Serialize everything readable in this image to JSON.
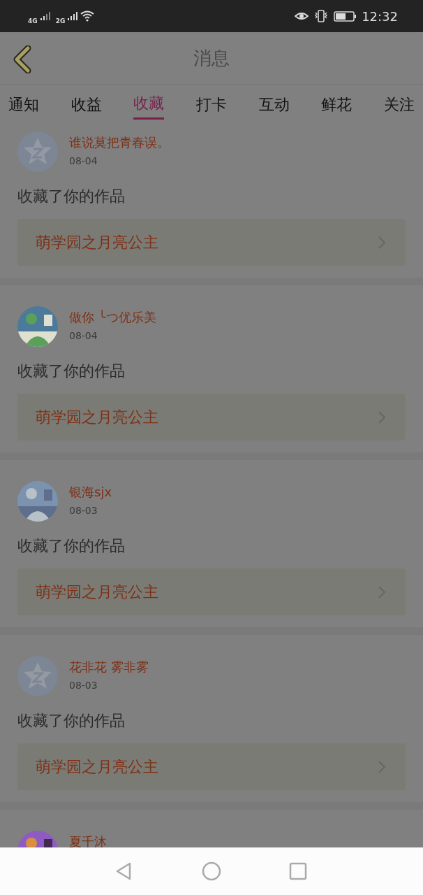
{
  "status_bar": {
    "signal_1": "4G",
    "signal_2": "2G",
    "time": "12:32"
  },
  "header": {
    "title": "消息"
  },
  "tabs": [
    {
      "label": "通知",
      "selected": false
    },
    {
      "label": "收益",
      "selected": false
    },
    {
      "label": "收藏",
      "selected": true
    },
    {
      "label": "打卡",
      "selected": false
    },
    {
      "label": "互动",
      "selected": false
    },
    {
      "label": "鲜花",
      "selected": false
    },
    {
      "label": "关注",
      "selected": false
    }
  ],
  "messages": [
    {
      "avatar": {
        "kind": "default"
      },
      "name": "谁说莫把青春误。",
      "date": "08-04",
      "action": "收藏了你的作品",
      "work_title": "萌学园之月亮公主"
    },
    {
      "name": "做你 ╰つ优乐美",
      "date": "08-04",
      "action": "收藏了你的作品",
      "work_title": "萌学园之月亮公主"
    },
    {
      "name": "银海sjx",
      "date": "08-03",
      "action": "收藏了你的作品",
      "work_title": "萌学园之月亮公主"
    },
    {
      "avatar": {
        "kind": "default"
      },
      "name": "花非花 雾非雾",
      "date": "08-03",
      "action": "收藏了你的作品",
      "work_title": "萌学园之月亮公主"
    },
    {
      "name": "夏千沐"
    }
  ]
}
